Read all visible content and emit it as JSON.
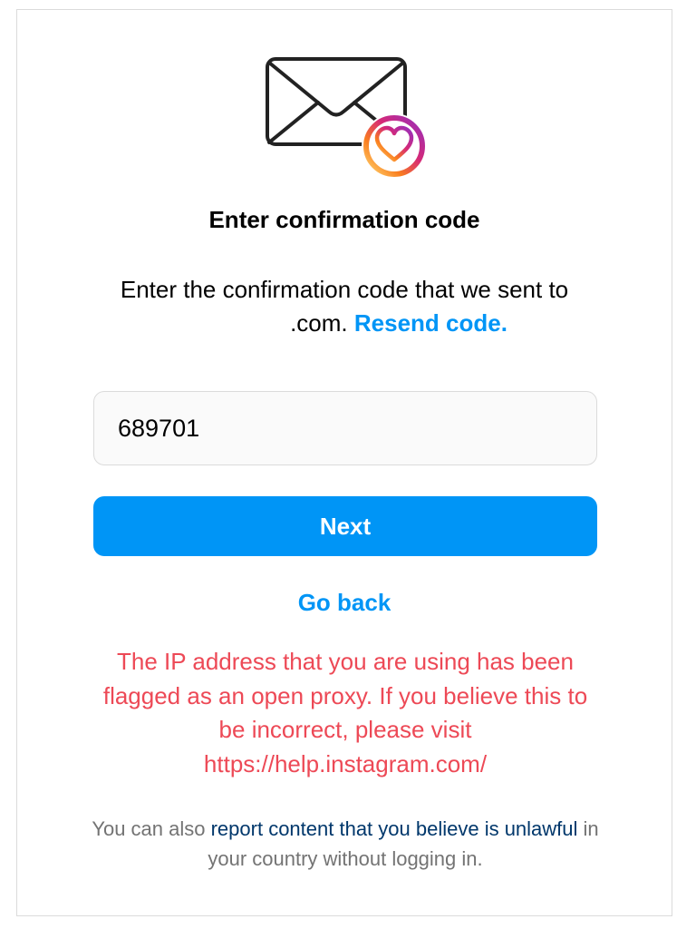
{
  "header": {
    "title": "Enter confirmation code"
  },
  "description": {
    "line1": "Enter the confirmation code that we sent to",
    "email_suffix": ".com.",
    "resend_label": "Resend code."
  },
  "code_input": {
    "value": "689701"
  },
  "next_button": {
    "label": "Next"
  },
  "go_back": {
    "label": "Go back"
  },
  "error_message": {
    "text": "The IP address that you are using has been flagged as an open proxy. If you believe this to be incorrect, please visit https://help.instagram.com/"
  },
  "footer": {
    "prefix": "You can also ",
    "link_text": "report content that you believe is unlawful",
    "suffix": " in your country without logging in."
  },
  "colors": {
    "primary": "#0095f6",
    "error": "#ed4956",
    "footer_link": "#00376b",
    "muted": "#737373",
    "border": "#dbdbdb"
  },
  "icons": {
    "envelope": "envelope-icon",
    "heart_badge": "heart-badge-icon"
  }
}
